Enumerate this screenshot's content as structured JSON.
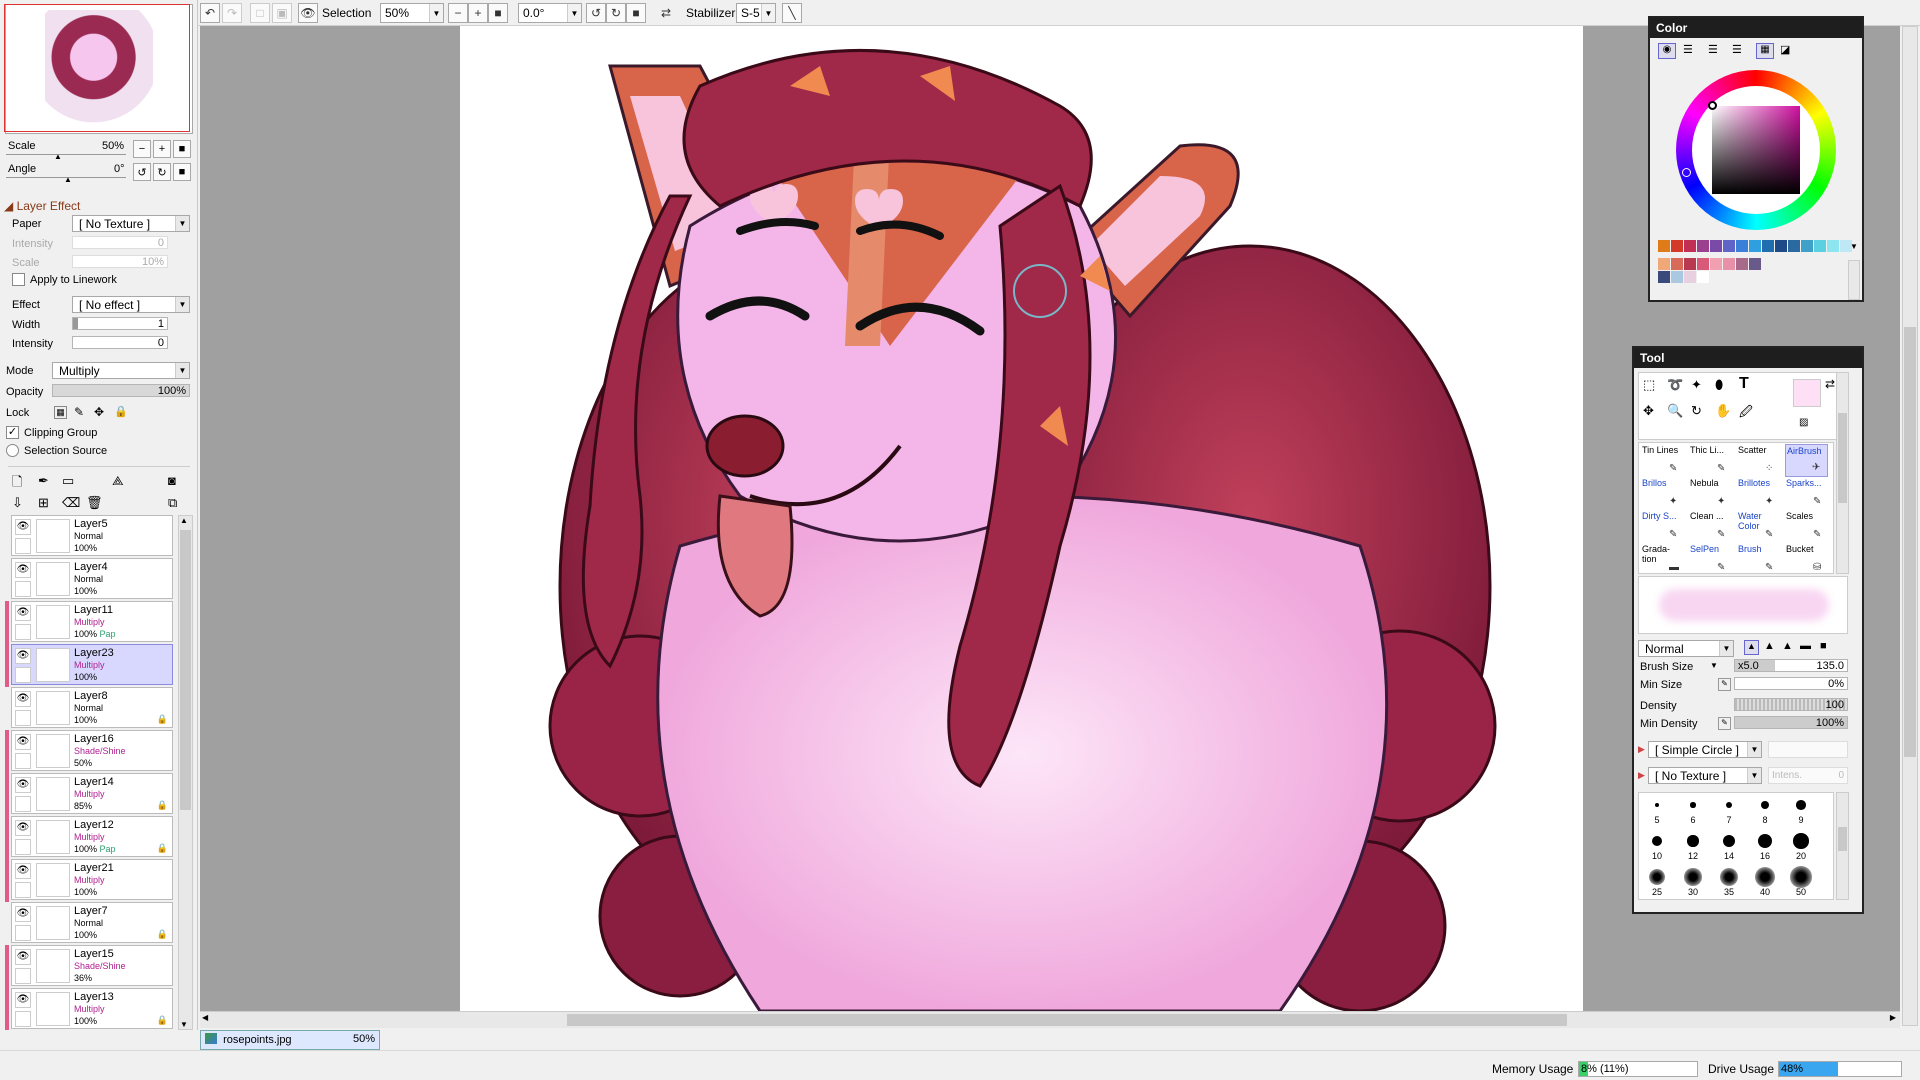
{
  "toolbar": {
    "selection_label": "Selection",
    "zoom_value": "50%",
    "rotation_value": "0.0°",
    "stabilizer_label": "Stabilizer",
    "stabilizer_value": "S-5"
  },
  "navigator": {
    "scale_label": "Scale",
    "scale_value": "50%",
    "angle_label": "Angle",
    "angle_value": "0°"
  },
  "layer_effect": {
    "header": "Layer Effect",
    "paper_label": "Paper",
    "paper_value": "[ No Texture ]",
    "intensity_label": "Intensity",
    "intensity_value": "0",
    "scale_label": "Scale",
    "scale_value": "10%",
    "apply_linework": "Apply to Linework",
    "effect_label": "Effect",
    "effect_value": "[ No effect ]",
    "width_label": "Width",
    "width_value": "1",
    "intensity2_label": "Intensity",
    "intensity2_value": "0"
  },
  "layer_props": {
    "mode_label": "Mode",
    "mode_value": "Multiply",
    "opacity_label": "Opacity",
    "opacity_value": "100%",
    "opacity_fraction": 1.0,
    "lock_label": "Lock",
    "clipping_group": "Clipping Group",
    "selection_source": "Selection Source"
  },
  "layers": [
    {
      "name": "Layer5",
      "mode": "Normal",
      "opacity": "100%",
      "extra": "",
      "clip": false,
      "selected": false,
      "locked": false
    },
    {
      "name": "Layer4",
      "mode": "Normal",
      "opacity": "100%",
      "extra": "",
      "clip": false,
      "selected": false,
      "locked": false
    },
    {
      "name": "Layer11",
      "mode": "Multiply",
      "opacity": "100%",
      "extra": "Pap",
      "clip": true,
      "selected": false,
      "locked": false
    },
    {
      "name": "Layer23",
      "mode": "Multiply",
      "opacity": "100%",
      "extra": "",
      "clip": true,
      "selected": true,
      "locked": false
    },
    {
      "name": "Layer8",
      "mode": "Normal",
      "opacity": "100%",
      "extra": "",
      "clip": false,
      "selected": false,
      "locked": true
    },
    {
      "name": "Layer16",
      "mode": "Shade/Shine",
      "opacity": "50%",
      "extra": "",
      "clip": true,
      "selected": false,
      "locked": false
    },
    {
      "name": "Layer14",
      "mode": "Multiply",
      "opacity": "85%",
      "extra": "",
      "clip": true,
      "selected": false,
      "locked": true
    },
    {
      "name": "Layer12",
      "mode": "Multiply",
      "opacity": "100%",
      "extra": "Pap",
      "clip": true,
      "selected": false,
      "locked": true
    },
    {
      "name": "Layer21",
      "mode": "Multiply",
      "opacity": "100%",
      "extra": "",
      "clip": true,
      "selected": false,
      "locked": false
    },
    {
      "name": "Layer7",
      "mode": "Normal",
      "opacity": "100%",
      "extra": "",
      "clip": false,
      "selected": false,
      "locked": true
    },
    {
      "name": "Layer15",
      "mode": "Shade/Shine",
      "opacity": "36%",
      "extra": "",
      "clip": true,
      "selected": false,
      "locked": false
    },
    {
      "name": "Layer13",
      "mode": "Multiply",
      "opacity": "100%",
      "extra": "",
      "clip": true,
      "selected": false,
      "locked": true
    }
  ],
  "file": {
    "name": "rosepoints.jpg",
    "zoom": "50%"
  },
  "status": {
    "memory_label": "Memory Usage",
    "memory_value": "8% (11%)",
    "memory_fraction": 0.08,
    "drive_label": "Drive Usage",
    "drive_value": "48%",
    "drive_fraction": 0.48
  },
  "color_panel": {
    "title": "Color",
    "palette_row1": [
      "#e07b1a",
      "#d43a2a",
      "#c22f55",
      "#9b3f8f",
      "#7a4aa8",
      "#5e64c8",
      "#3a7fd8",
      "#2f9fe0",
      "#1f6fb0",
      "#1e4b88",
      "#2a6aa0",
      "#3fa0c8",
      "#5ad0e0",
      "#8de6ef",
      "#bfe8f5"
    ],
    "palette_row2": [
      "#f0a878",
      "#d86a5a",
      "#b83a50",
      "#d85a78",
      "#f0a0b0",
      "#e890a8",
      "#a86a8a",
      "#6a5a8a",
      "#3a4a7a",
      "#aac8e0",
      "#e8d0e0",
      "#ffffff"
    ]
  },
  "tool_panel": {
    "title": "Tool",
    "brushes": [
      {
        "label": "Tin Lines",
        "blue": false,
        "selected": false
      },
      {
        "label": "Thic Li...",
        "blue": false,
        "selected": false
      },
      {
        "label": "Scatter",
        "blue": false,
        "selected": false
      },
      {
        "label": "AirBrush",
        "blue": true,
        "selected": true
      },
      {
        "label": "Brillos",
        "blue": true,
        "selected": false
      },
      {
        "label": "Nebula",
        "blue": false,
        "selected": false
      },
      {
        "label": "Brillotes",
        "blue": true,
        "selected": false
      },
      {
        "label": "Sparks...",
        "blue": true,
        "selected": false
      },
      {
        "label": "Dirty S...",
        "blue": true,
        "selected": false
      },
      {
        "label": "Clean ...",
        "blue": false,
        "selected": false
      },
      {
        "label": "Water Color",
        "blue": true,
        "selected": false
      },
      {
        "label": "Scales",
        "blue": false,
        "selected": false
      },
      {
        "label": "Grada-tion",
        "blue": false,
        "selected": false
      },
      {
        "label": "SelPen",
        "blue": true,
        "selected": false
      },
      {
        "label": "Brush",
        "blue": true,
        "selected": false
      },
      {
        "label": "Bucket",
        "blue": false,
        "selected": false
      }
    ],
    "blend_mode": "Normal",
    "brush_size_label": "Brush Size",
    "brush_size_mult": "x5.0",
    "brush_size_value": "135.0",
    "min_size_label": "Min Size",
    "min_size_value": "0%",
    "density_label": "Density",
    "density_value": "100",
    "min_density_label": "Min Density",
    "min_density_value": "100%",
    "shape_value": "[ Simple Circle ]",
    "texture_value": "[ No Texture ]",
    "intens_placeholder": "Intens.",
    "intens_value": "0",
    "sizes": [
      "5",
      "6",
      "7",
      "8",
      "9",
      "10",
      "12",
      "14",
      "16",
      "20",
      "25",
      "30",
      "35",
      "40",
      "50"
    ]
  }
}
